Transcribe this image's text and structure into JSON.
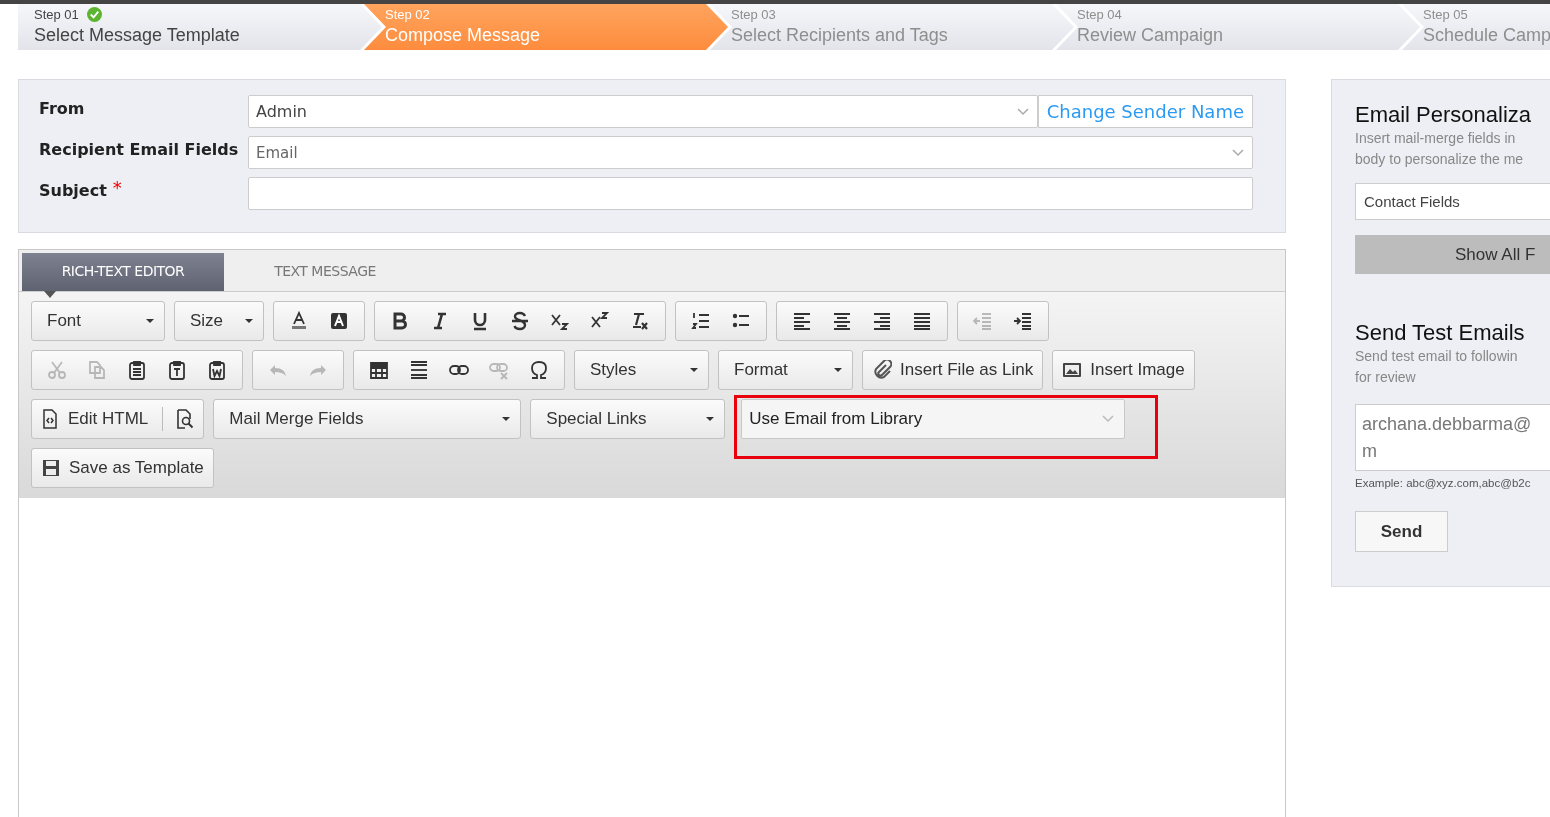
{
  "steps": [
    {
      "number": "Step 01",
      "title": "Select Message Template",
      "selected": false,
      "completed": true
    },
    {
      "number": "Step 02",
      "title": "Compose Message",
      "selected": true,
      "completed": false
    },
    {
      "number": "Step 03",
      "title": "Select Recipients and Tags",
      "selected": false,
      "completed": false
    },
    {
      "number": "Step 04",
      "title": "Review Campaign",
      "selected": false,
      "completed": false
    },
    {
      "number": "Step 05",
      "title": "Schedule Camp",
      "selected": false,
      "completed": false
    }
  ],
  "form": {
    "from": {
      "label": "From",
      "value": "Admin",
      "link": "Change Sender Name"
    },
    "recipient": {
      "label": "Recipient Email Fields",
      "value": "Email"
    },
    "subject": {
      "label": "Subject",
      "required_mark": "*"
    }
  },
  "editor": {
    "tabs": [
      {
        "label": "RICH-TEXT EDITOR",
        "selected": true
      },
      {
        "label": "TEXT MESSAGE",
        "selected": false
      }
    ],
    "toolbar": [
      [
        {
          "kind": "dropdown",
          "label": "Font"
        },
        {
          "kind": "dropdown",
          "label": "Size"
        },
        {
          "kind": "icons",
          "buttons": [
            {
              "disabled": false
            },
            {
              "disabled": false
            }
          ]
        },
        {
          "kind": "icons",
          "buttons": [
            {
              "disabled": false
            },
            {
              "disabled": false
            },
            {
              "disabled": false
            },
            {
              "disabled": false
            },
            {
              "disabled": false
            },
            {
              "disabled": false
            },
            {
              "disabled": false
            }
          ]
        },
        {
          "kind": "icons",
          "buttons": [
            {
              "disabled": false
            },
            {
              "disabled": false
            }
          ]
        },
        {
          "kind": "icons",
          "buttons": [
            {
              "disabled": false
            },
            {
              "disabled": false
            },
            {
              "disabled": false
            },
            {
              "disabled": false
            }
          ]
        },
        {
          "kind": "icons",
          "buttons": [
            {
              "disabled": true
            },
            {
              "disabled": false
            }
          ]
        }
      ],
      [
        {
          "kind": "icons",
          "buttons": [
            {
              "disabled": true
            },
            {
              "disabled": true
            },
            {
              "disabled": false
            },
            {
              "disabled": false
            },
            {
              "disabled": false
            }
          ]
        },
        {
          "kind": "icons",
          "buttons": [
            {
              "disabled": true
            },
            {
              "disabled": true
            }
          ]
        },
        {
          "kind": "icons",
          "buttons": [
            {
              "disabled": false
            },
            {
              "disabled": false
            },
            {
              "disabled": false
            },
            {
              "disabled": true
            },
            {
              "disabled": false
            }
          ]
        },
        {
          "kind": "dropdown",
          "label": "Styles"
        },
        {
          "kind": "dropdown",
          "label": "Format"
        },
        {
          "kind": "button",
          "label": "Insert File as Link"
        },
        {
          "kind": "button",
          "label": "Insert Image"
        }
      ],
      [
        {
          "kind": "button",
          "label": "Edit HTML"
        },
        {
          "kind": "dropdown",
          "label": "Mail Merge Fields"
        },
        {
          "kind": "dropdown",
          "label": "Special Links"
        },
        {
          "kind": "select",
          "label": "Use Email from Library",
          "highlighted": true
        }
      ],
      [
        {
          "kind": "button",
          "label": "Save as Template"
        }
      ]
    ]
  },
  "side": {
    "personalization": {
      "title": "Email Personaliza",
      "lines": [
        "Insert mail-merge fields in",
        "body to personalize the me"
      ],
      "select": "Contact Fields",
      "button": "Show All F"
    },
    "test": {
      "title": "Send Test Emails",
      "lines": [
        "Send test email to followin",
        "for review"
      ],
      "value_lines": [
        "archana.debbarma@",
        "m"
      ],
      "hint": "Example: abc@xyz.com,abc@b2c",
      "button": "Send"
    }
  }
}
